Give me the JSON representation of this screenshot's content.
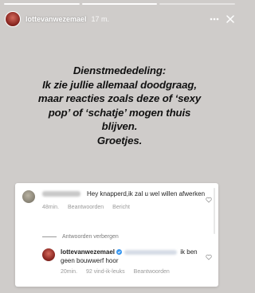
{
  "story": {
    "username": "lottevanwezemael",
    "time": "17 m.",
    "segments": 3,
    "active_segment": 1
  },
  "header_icons": [
    "more-icon",
    "close-icon"
  ],
  "announcement": {
    "lines": [
      "Dienstmededeling:",
      "Ik zie jullie allemaal doodgraag,",
      "maar reacties zoals deze of ‘sexy",
      "pop’ of ‘schatje’ mogen thuis",
      "blijven.",
      "Groetjes."
    ]
  },
  "comment": {
    "text": "Hey knapperd,ik zal u wel willen afwerken",
    "time": "48min.",
    "reply_label": "Beantwoorden",
    "message_label": "Bericht"
  },
  "hide_replies_label": "Antwoorden verbergen",
  "reply": {
    "username": "lottevanwezemael",
    "text_after": "ik ben geen bouwwerf hoor",
    "time": "20min.",
    "likes": "92 vind-ik-leuks",
    "reply_label": "Beantwoorden"
  },
  "colors": {
    "background": "#cfccca",
    "verified": "#3897f0",
    "card": "#ffffff"
  }
}
